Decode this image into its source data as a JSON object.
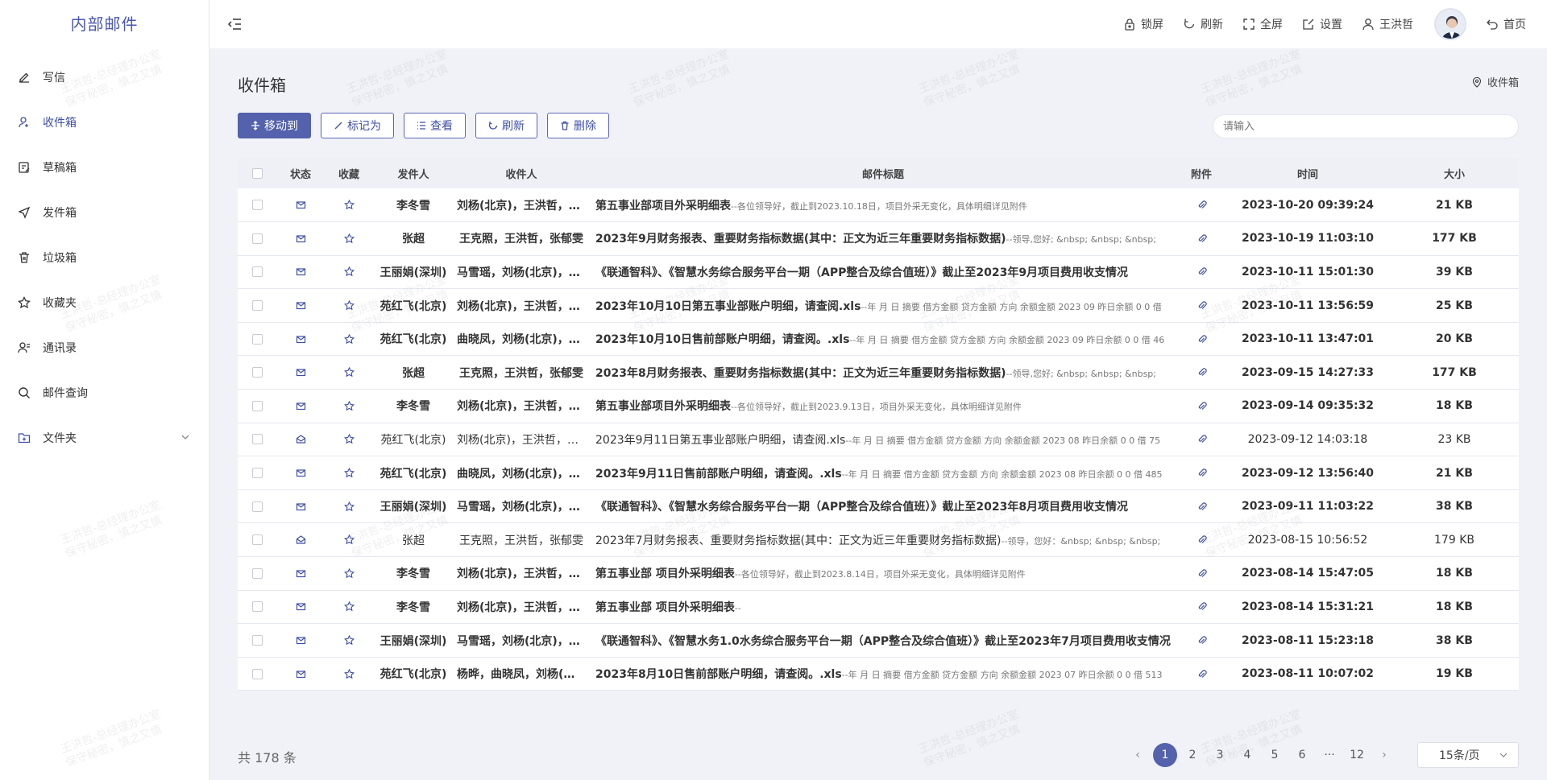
{
  "brand": "内部邮件",
  "sidebar": {
    "items": [
      {
        "label": "写信",
        "icon": "pen-icon"
      },
      {
        "label": "收件箱",
        "icon": "user-plus-icon"
      },
      {
        "label": "草稿箱",
        "icon": "draft-icon"
      },
      {
        "label": "发件箱",
        "icon": "send-icon"
      },
      {
        "label": "垃圾箱",
        "icon": "trash-icon"
      },
      {
        "label": "收藏夹",
        "icon": "star-icon"
      },
      {
        "label": "通讯录",
        "icon": "contacts-icon"
      },
      {
        "label": "邮件查询",
        "icon": "search-icon"
      },
      {
        "label": "文件夹",
        "icon": "folder-plus-icon"
      }
    ]
  },
  "header": {
    "lock": "锁屏",
    "refresh": "刷新",
    "fullscreen": "全屏",
    "settings": "设置",
    "user": "王洪哲",
    "home": "首页"
  },
  "page": {
    "title": "收件箱",
    "breadcrumb": "收件箱",
    "search_placeholder": "请输入"
  },
  "toolbar": {
    "move": "移动到",
    "mark": "标记为",
    "view": "查看",
    "refresh": "刷新",
    "delete": "删除"
  },
  "table": {
    "columns": [
      "状态",
      "收藏",
      "发件人",
      "收件人",
      "邮件标题",
      "附件",
      "时间",
      "大小"
    ],
    "rows": [
      {
        "unread": true,
        "sender": "李冬雪",
        "recipients": "刘杨(北京)，王洪哲，张郁雯",
        "subject": "第五事业部项目外采明细表",
        "preview": "--各位领导好，截止到2023.10.18日，项目外采无变化，具体明细详见附件",
        "time": "2023-10-20 09:39:24",
        "size": "21 KB"
      },
      {
        "unread": true,
        "sender": "张超",
        "recipients": "王克照，王洪哲，张郁雯",
        "subject": "2023年9月财务报表、重要财务指标数据(其中：正文为近三年重要财务指标数据)",
        "preview": "--领导,您好; &nbsp; &nbsp; &nbsp;",
        "time": "2023-10-19 11:03:10",
        "size": "177 KB"
      },
      {
        "unread": true,
        "sender": "王丽娟(深圳)",
        "recipients": "马雪瑶，刘杨(北京)，李冬雪",
        "subject": "《联通智科》、《智慧水务综合服务平台一期（APP整合及综合值班）》截止至2023年9月项目费用收支情况",
        "preview": "",
        "time": "2023-10-11 15:01:30",
        "size": "39 KB"
      },
      {
        "unread": true,
        "sender": "苑红飞(北京)",
        "recipients": "刘杨(北京)，王洪哲，张郁雯",
        "subject": "2023年10月10日第五事业部账户明细，请查阅.xls",
        "preview": "--年 月 日 摘要 借方金额 贷方金额 方向 余额金额 2023 09 昨日余额 0 0 借",
        "time": "2023-10-11 13:56:59",
        "size": "25 KB"
      },
      {
        "unread": true,
        "sender": "苑红飞(北京)",
        "recipients": "曲晓凤，刘杨(北京)，王洪哲，",
        "subject": "2023年10月10日售前部账户明细，请查阅。.xls",
        "preview": "--年 月 日 摘要 借方金额 贷方金额 方向 余额金额 2023 09 昨日余额 0 0 借 46",
        "time": "2023-10-11 13:47:01",
        "size": "20 KB"
      },
      {
        "unread": true,
        "sender": "张超",
        "recipients": "王克照，王洪哲，张郁雯",
        "subject": "2023年8月财务报表、重要财务指标数据(其中：正文为近三年重要财务指标数据)",
        "preview": "--领导,您好; &nbsp; &nbsp; &nbsp;",
        "time": "2023-09-15 14:27:33",
        "size": "177 KB"
      },
      {
        "unread": true,
        "sender": "李冬雪",
        "recipients": "刘杨(北京)，王洪哲，张郁雯",
        "subject": "第五事业部项目外采明细表",
        "preview": "--各位领导好，截止到2023.9.13日，项目外采无变化，具体明细详见附件",
        "time": "2023-09-14 09:35:32",
        "size": "18 KB"
      },
      {
        "unread": false,
        "sender": "苑红飞(北京)",
        "recipients": "刘杨(北京)，王洪哲，张郁雯",
        "subject": "2023年9月11日第五事业部账户明细，请查阅.xls",
        "preview": "--年 月 日 摘要 借方金额 贷方金额 方向 余额金额 2023 08 昨日余额 0 0 借 75",
        "time": "2023-09-12 14:03:18",
        "size": "23 KB"
      },
      {
        "unread": true,
        "sender": "苑红飞(北京)",
        "recipients": "曲晓凤，刘杨(北京)，王洪哲，",
        "subject": "2023年9月11日售前部账户明细，请查阅。.xls",
        "preview": "--年 月 日 摘要 借方金额 贷方金额 方向 余额金额 2023 08 昨日余额 0 0 借 485",
        "time": "2023-09-12 13:56:40",
        "size": "21 KB"
      },
      {
        "unread": true,
        "sender": "王丽娟(深圳)",
        "recipients": "马雪瑶，刘杨(北京)，李冬雪，",
        "subject": "《联通智科》、《智慧水务综合服务平台一期（APP整合及综合值班）》截止至2023年8月项目费用收支情况",
        "preview": "",
        "time": "2023-09-11 11:03:22",
        "size": "38 KB"
      },
      {
        "unread": false,
        "sender": "张超",
        "recipients": "王克照，王洪哲，张郁雯",
        "subject": "2023年7月财务报表、重要财务指标数据(其中：正文为近三年重要财务指标数据)",
        "preview": "--领导，您好：&nbsp; &nbsp; &nbsp;",
        "time": "2023-08-15 10:56:52",
        "size": "179 KB"
      },
      {
        "unread": true,
        "sender": "李冬雪",
        "recipients": "刘杨(北京)，王洪哲，张郁雯",
        "subject": "第五事业部 项目外采明细表",
        "preview": "--各位领导好，截止到2023.8.14日，项目外采无变化，具体明细详见附件",
        "time": "2023-08-14 15:47:05",
        "size": "18 KB"
      },
      {
        "unread": true,
        "sender": "李冬雪",
        "recipients": "刘杨(北京)，王洪哲，张郁雯",
        "subject": "第五事业部 项目外采明细表",
        "preview": "--",
        "time": "2023-08-14 15:31:21",
        "size": "18 KB"
      },
      {
        "unread": true,
        "sender": "王丽娟(深圳)",
        "recipients": "马雪瑶，刘杨(北京)，李冬雪，",
        "subject": "《联通智科》、《智慧水务1.0水务综合服务平台一期（APP整合及综合值班）》截止至2023年7月项目费用收支情况",
        "preview": "",
        "time": "2023-08-11 15:23:18",
        "size": "38 KB"
      },
      {
        "unread": true,
        "sender": "苑红飞(北京)",
        "recipients": "杨晔，曲晓凤，刘杨(北京)，王",
        "subject": "2023年8月10日售前部账户明细，请查阅。.xls",
        "preview": "--年 月 日 摘要 借方金额 贷方金额 方向 余额金额 2023 07 昨日余额 0 0 借 513",
        "time": "2023-08-11 10:07:02",
        "size": "19 KB"
      }
    ]
  },
  "footer": {
    "total": "共 178 条",
    "pages": [
      "1",
      "2",
      "3",
      "4",
      "5",
      "6",
      "···",
      "12"
    ],
    "page_size": "15条/页"
  },
  "watermark": {
    "line1": "王洪哲-总经理办公室",
    "line2": "保守秘密，慎之又慎"
  },
  "colors": {
    "accent": "#5461ad",
    "brand_text": "#4a58b0",
    "background": "#f0f2f7"
  }
}
